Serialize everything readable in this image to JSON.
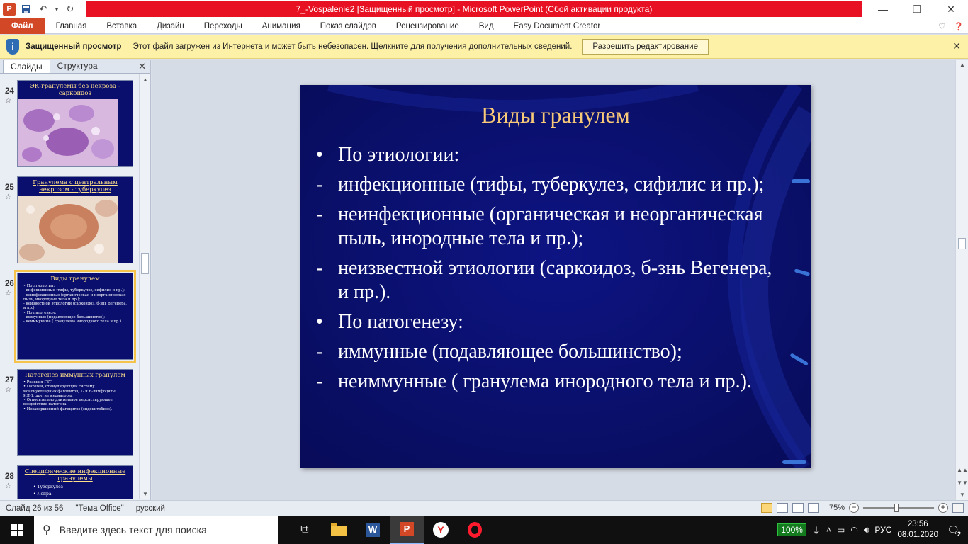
{
  "window": {
    "title": "7_-Vospalenie2 [Защищенный просмотр]  -  Microsoft PowerPoint (Сбой активации продукта)",
    "app_logo": "P",
    "controls": {
      "minimize": "—",
      "restore": "❐",
      "close": "✕"
    }
  },
  "ribbon": {
    "tabs": [
      "Файл",
      "Главная",
      "Вставка",
      "Дизайн",
      "Переходы",
      "Анимация",
      "Показ слайдов",
      "Рецензирование",
      "Вид",
      "Easy Document Creator"
    ]
  },
  "protected_view": {
    "title": "Защищенный просмотр",
    "message": "Этот файл загружен из Интернета и может быть небезопасен. Щелкните для получения дополнительных сведений.",
    "button": "Разрешить редактирование"
  },
  "left_pane": {
    "tabs": [
      "Слайды",
      "Структура"
    ],
    "thumbnails": [
      {
        "number": "24",
        "title": "ЭК-гранулемы без некроза - саркоидоз",
        "image": "histology-purple",
        "body": []
      },
      {
        "number": "25",
        "title": "Гранулема с центральным некрозом - туберкулез",
        "image": "histology-pink",
        "body": []
      },
      {
        "number": "26",
        "title": "Виды гранулем",
        "image": "",
        "body": [
          "• По этиологии:",
          "- инфекционные (тифы, туберкулез, сифилис и пр.);",
          "- неинфекционные (органическая и неорганическая пыль, инородные тела и пр.);",
          "- неизвестной этиологии (саркоидоз, б-знь Вегенера, и пр.).",
          "• По патогенезу:",
          "- иммунные (подавляющее большинство);",
          "- неиммунные ( гранулема инородного тела и пр.)."
        ]
      },
      {
        "number": "27",
        "title": "Патогенез иммунных гранулем",
        "image": "",
        "body": [
          "• Реакция ГЗТ.",
          "• Патоген, стимулирующий систему мононуклеарных фагоцитов, Т- и В-лимфоциты, ИЛ-1, другие медиаторы.",
          "• Относительно длительное персистирующее воздействие патогена.",
          "• Незавершенный фагоцитоз (эндоцитобиоз)."
        ]
      },
      {
        "number": "28",
        "title": "Специфические инфекционные гранулемы",
        "image": "",
        "body": [
          "• Туберкулез",
          "• Лепра"
        ]
      }
    ],
    "selected": "26"
  },
  "slide": {
    "title": "Виды гранулем",
    "lines": [
      {
        "marker": "•",
        "text": "По этиологии:"
      },
      {
        "marker": "-",
        "text": "инфекционные (тифы, туберкулез, сифилис и пр.);"
      },
      {
        "marker": "-",
        "text": "неинфекционные (органическая и неорганическая пыль, инородные тела и пр.);"
      },
      {
        "marker": "-",
        "text": "неизвестной этиологии (саркоидоз, б-знь Вегенера, и пр.)."
      },
      {
        "marker": "•",
        "text": "По патогенезу:"
      },
      {
        "marker": "-",
        "text": "иммунные (подавляющее большинство);"
      },
      {
        "marker": "-",
        "text": "неиммунные ( гранулема инородного тела и пр.)."
      }
    ],
    "colors": {
      "background": "#0a0f6e",
      "title": "#f7c978",
      "text": "#ffffff",
      "accent": "#3a73d8"
    }
  },
  "status_bar": {
    "slide_info": "Слайд 26 из 56",
    "theme": "\"Тема Office\"",
    "language": "русский",
    "zoom": "75%"
  },
  "taskbar": {
    "search_placeholder": "Введите здесь текст для поиска",
    "battery": "100%",
    "language": "РУС",
    "time": "23:56",
    "date": "08.01.2020",
    "notifications": "2"
  }
}
